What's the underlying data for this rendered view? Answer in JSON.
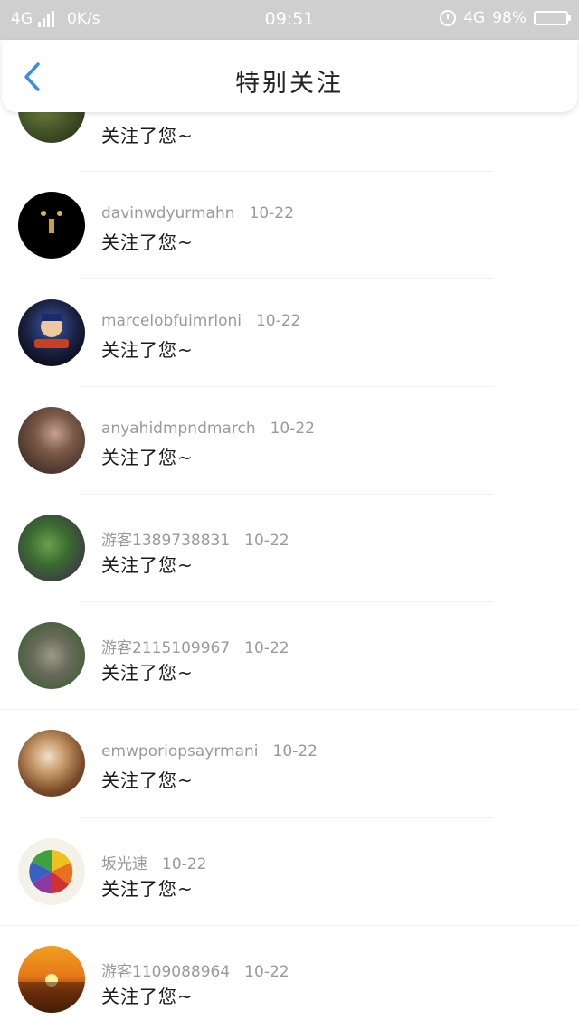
{
  "status_bar": {
    "network": "4G",
    "speed": "0K/s",
    "time": "09:51",
    "network_right": "4G",
    "battery_percent": "98%",
    "icons": [
      "signal-icon",
      "alarm-icon",
      "battery-icon"
    ]
  },
  "header": {
    "title": "特别关注",
    "back_icon": "chevron-left-icon",
    "accent_color": "#3a8ee6"
  },
  "items": [
    {
      "user": "",
      "date": "",
      "message": "关注了您~",
      "avatar_colors": [
        "#6b7a3a",
        "#2b3520"
      ]
    },
    {
      "user": "davinwdyurmahn",
      "date": "10-22",
      "message": "关注了您~",
      "avatar_colors": [
        "#111111",
        "#000000"
      ]
    },
    {
      "user": "marcelobfuimrloni",
      "date": "10-22",
      "message": "关注了您~",
      "avatar_colors": [
        "#2b3a6a",
        "#0a0a0a"
      ]
    },
    {
      "user": "anyahidmpndmarch",
      "date": "10-22",
      "message": "关注了您~",
      "avatar_colors": [
        "#7a5a48",
        "#2a1a18"
      ]
    },
    {
      "user": "游客1389738831",
      "date": "10-22",
      "message": "关注了您~",
      "avatar_colors": [
        "#4a7a3a",
        "#3a2050"
      ]
    },
    {
      "user": "游客2115109967",
      "date": "10-22",
      "message": "关注了您~",
      "avatar_colors": [
        "#8a8a7a",
        "#2e5a28"
      ]
    },
    {
      "user": "emwporiopsayrmani",
      "date": "10-22",
      "message": "关注了您~",
      "avatar_colors": [
        "#c89a6a",
        "#5a3a20"
      ]
    },
    {
      "user": "坂光速",
      "date": "10-22",
      "message": "关注了您~",
      "avatar_colors": [
        "#e8d040",
        "#3aa040"
      ]
    },
    {
      "user": "游客1109088964",
      "date": "10-22",
      "message": "关注了您~",
      "avatar_colors": [
        "#f0a020",
        "#5a2a10"
      ]
    }
  ]
}
